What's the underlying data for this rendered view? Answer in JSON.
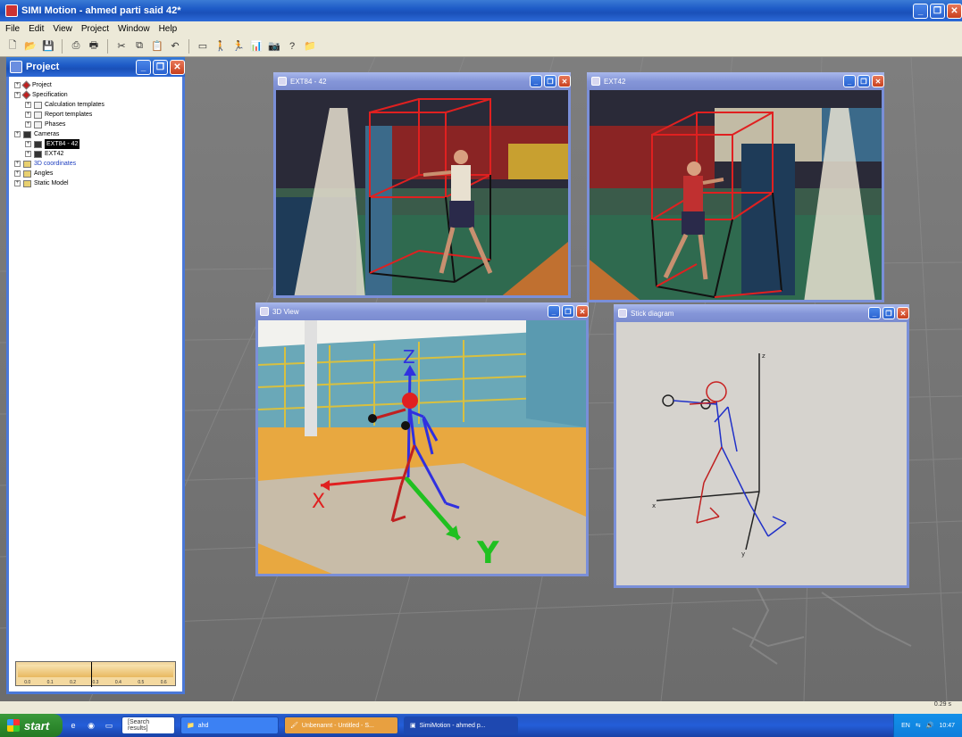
{
  "app": {
    "title": "SIMI Motion - ahmed parti said 42*"
  },
  "menu": [
    "File",
    "Edit",
    "View",
    "Project",
    "Window",
    "Help"
  ],
  "project_panel": {
    "title": "Project",
    "tree": [
      {
        "label": "Project",
        "depth": 0,
        "icon": "red-diamond-icon"
      },
      {
        "label": "Specification",
        "depth": 0,
        "icon": "red-diamond-icon"
      },
      {
        "label": "Calculation templates",
        "depth": 1,
        "icon": "document-icon"
      },
      {
        "label": "Report templates",
        "depth": 1,
        "icon": "document-icon"
      },
      {
        "label": "Phases",
        "depth": 1,
        "icon": "document-icon"
      },
      {
        "label": "Cameras",
        "depth": 0,
        "icon": "camera-icon"
      },
      {
        "label": "EXT84 - 42",
        "depth": 1,
        "icon": "camera-icon",
        "selected": true
      },
      {
        "label": "EXT42",
        "depth": 1,
        "icon": "camera-icon"
      },
      {
        "label": "3D coordinates",
        "depth": 0,
        "icon": "folder-icon",
        "blue": true
      },
      {
        "label": "Angles",
        "depth": 0,
        "icon": "folder-icon"
      },
      {
        "label": "Static Model",
        "depth": 0,
        "icon": "folder-icon"
      }
    ],
    "timeline_ticks": [
      "0.0",
      "0.1",
      "0.2",
      "0.3",
      "0.4",
      "0.5",
      "0.6"
    ],
    "timeline_position": 0.47
  },
  "windows": {
    "cam1": {
      "title": "EXT84 - 42"
    },
    "cam2": {
      "title": "EXT42"
    },
    "view3d": {
      "title": "3D View",
      "axis_x": "X",
      "axis_y": "Y",
      "axis_z": "Z"
    },
    "stick": {
      "title": "Stick diagram",
      "axis_z": "z",
      "axis_x": "x",
      "axis_y": "y"
    }
  },
  "status": {
    "time": "0.29 s"
  },
  "taskbar": {
    "start": "start",
    "items": [
      {
        "label": "[Search results]",
        "style": "white"
      },
      {
        "label": "ahd"
      },
      {
        "label": "Unbenannt - Untitled - S...",
        "style": "orange"
      },
      {
        "label": "SimiMotion - ahmed p...",
        "style": "active"
      }
    ],
    "tray_lang": "EN",
    "clock": "10:47"
  }
}
